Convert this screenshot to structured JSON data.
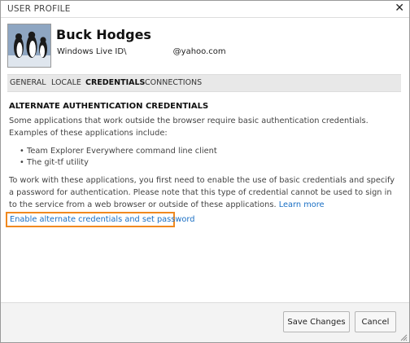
{
  "dialog": {
    "title": "USER PROFILE",
    "close_icon": "close-icon",
    "avatar_icon": "penguin-avatar-icon"
  },
  "user": {
    "name": "Buck Hodges",
    "id_text": "Windows Live ID\\                  @yahoo.com"
  },
  "tabs": [
    {
      "label": "GENERAL",
      "active": false
    },
    {
      "label": "LOCALE",
      "active": false
    },
    {
      "label": "CREDENTIALS",
      "active": true
    },
    {
      "label": "CONNECTIONS",
      "active": false
    }
  ],
  "content": {
    "heading": "ALTERNATE AUTHENTICATION CREDENTIALS",
    "intro": "Some applications that work outside the browser require basic authentication credentials. Examples of these applications include:",
    "bullets": [
      "Team Explorer Everywhere command line client",
      "The git-tf utility"
    ],
    "detail": "To work with these applications, you first need to enable the use of basic credentials and specify a password for authentication. Please note that this type of credential cannot be used to sign in to the service from a web browser or outside of these applications.",
    "learn_more": "Learn more",
    "enable_link": "Enable alternate credentials and set password"
  },
  "footer": {
    "save_label": "Save Changes",
    "cancel_label": "Cancel"
  },
  "colors": {
    "link": "#1a6fc4",
    "highlight": "#f0891f"
  }
}
